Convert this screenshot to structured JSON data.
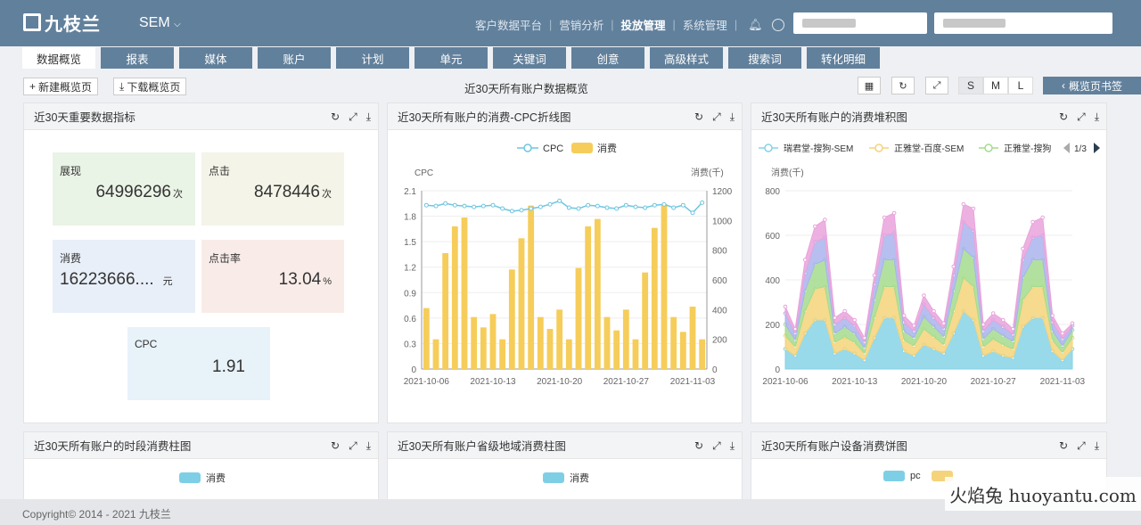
{
  "header": {
    "logo_text": "九枝兰",
    "product": "SEM",
    "nav": [
      "客户数据平台",
      "营销分析",
      "投放管理",
      "系统管理"
    ],
    "active_nav": "投放管理"
  },
  "tabs": [
    "数据概览",
    "报表",
    "媒体",
    "账户",
    "计划",
    "单元",
    "关键词",
    "创意",
    "高级样式",
    "搜索词",
    "转化明细"
  ],
  "toolbar": {
    "new_label": "新建概览页",
    "download_label": "下载概览页",
    "page_title": "近30天所有账户数据概览",
    "sizes": [
      "S",
      "M",
      "L"
    ],
    "active_size": "S",
    "bookmark_label": "概览页书签"
  },
  "panels": {
    "kpi": {
      "title": "近30天重要数据指标",
      "items": [
        {
          "label": "展现",
          "value": "64996296",
          "unit": "次",
          "color": "#eaf4e6"
        },
        {
          "label": "点击",
          "value": "8478446",
          "unit": "次",
          "color": "#f4f4e8"
        },
        {
          "label": "消费",
          "value": "16223666....",
          "unit": "元",
          "color": "#e8eff8"
        },
        {
          "label": "点击率",
          "value": "13.04",
          "unit": "%",
          "color": "#f9ece8"
        },
        {
          "label": "CPC",
          "value": "1.91",
          "unit": "",
          "color": "#e8f2f9"
        }
      ]
    },
    "cpc": {
      "title": "近30天所有账户的消费-CPC折线图"
    },
    "stack": {
      "title": "近30天所有账户的消费堆积图"
    },
    "hour": {
      "title": "近30天所有账户的时段消费柱图",
      "legend": "消费"
    },
    "region": {
      "title": "近30天所有账户省级地域消费柱图",
      "legend": "消费"
    },
    "device": {
      "title": "近30天所有账户设备消费饼图",
      "legend": [
        "pc"
      ]
    }
  },
  "chart_data": [
    {
      "type": "bar",
      "title": "",
      "left_axis_label": "CPC",
      "right_axis_label": "消费(千)",
      "legend": [
        "CPC",
        "消费"
      ],
      "x": [
        "2021-10-06",
        "2021-10-07",
        "2021-10-08",
        "2021-10-09",
        "2021-10-10",
        "2021-10-11",
        "2021-10-12",
        "2021-10-13",
        "2021-10-14",
        "2021-10-15",
        "2021-10-16",
        "2021-10-17",
        "2021-10-18",
        "2021-10-19",
        "2021-10-20",
        "2021-10-21",
        "2021-10-22",
        "2021-10-23",
        "2021-10-24",
        "2021-10-25",
        "2021-10-26",
        "2021-10-27",
        "2021-10-28",
        "2021-10-29",
        "2021-10-30",
        "2021-10-31",
        "2021-11-01",
        "2021-11-02",
        "2021-11-03",
        "2021-11-04"
      ],
      "x_ticks": [
        "2021-10-06",
        "2021-10-13",
        "2021-10-20",
        "2021-10-27",
        "2021-11-03"
      ],
      "consumption": [
        410,
        200,
        780,
        960,
        1020,
        350,
        280,
        370,
        200,
        670,
        880,
        1100,
        350,
        270,
        400,
        200,
        680,
        960,
        1010,
        350,
        260,
        400,
        200,
        650,
        950,
        1110,
        350,
        250,
        420,
        200
      ],
      "cpc": [
        1.93,
        1.92,
        1.95,
        1.93,
        1.92,
        1.91,
        1.92,
        1.93,
        1.89,
        1.86,
        1.87,
        1.89,
        1.91,
        1.94,
        1.98,
        1.9,
        1.89,
        1.93,
        1.92,
        1.9,
        1.89,
        1.93,
        1.91,
        1.9,
        1.93,
        1.94,
        1.9,
        1.93,
        1.84,
        1.96
      ],
      "left_ticks": [
        0,
        0.3,
        0.6,
        0.9,
        1.2,
        1.5,
        1.8,
        2.1
      ],
      "right_ticks": [
        0,
        200,
        400,
        600,
        800,
        1000,
        1200
      ],
      "series_colors": {
        "cpc": "#6fc6e0",
        "consumption": "#f6cd5a"
      }
    },
    {
      "type": "area",
      "title": "",
      "ylabel": "消费(千)",
      "legend": [
        "瑞君堂-搜狗-SEM",
        "正雅堂-百度-SEM",
        "正雅堂-搜狗"
      ],
      "legend_page": "1/3",
      "x_ticks": [
        "2021-10-06",
        "2021-10-13",
        "2021-10-20",
        "2021-10-27",
        "2021-11-03"
      ],
      "y_ticks": [
        0,
        200,
        400,
        600,
        800
      ],
      "layers": [
        {
          "color": "#86d3e6",
          "values": [
            90,
            60,
            160,
            220,
            220,
            70,
            90,
            70,
            40,
            140,
            230,
            230,
            80,
            60,
            110,
            90,
            70,
            160,
            260,
            220,
            60,
            80,
            60,
            50,
            190,
            230,
            230,
            80,
            40,
            90
          ]
        },
        {
          "color": "#f5d37a",
          "values": [
            60,
            40,
            100,
            140,
            150,
            50,
            55,
            50,
            30,
            90,
            140,
            140,
            50,
            45,
            70,
            55,
            40,
            100,
            150,
            150,
            40,
            55,
            50,
            40,
            120,
            140,
            140,
            50,
            35,
            50
          ]
        },
        {
          "color": "#a5dc8e",
          "values": [
            50,
            30,
            90,
            110,
            120,
            40,
            45,
            40,
            25,
            80,
            120,
            120,
            40,
            35,
            55,
            45,
            35,
            90,
            130,
            130,
            35,
            45,
            40,
            35,
            100,
            120,
            120,
            40,
            30,
            35
          ]
        },
        {
          "color": "#a9b4ec",
          "values": [
            50,
            30,
            80,
            100,
            100,
            40,
            40,
            35,
            25,
            70,
            110,
            120,
            40,
            30,
            55,
            40,
            35,
            70,
            120,
            120,
            35,
            40,
            40,
            30,
            80,
            100,
            110,
            40,
            30,
            20
          ]
        },
        {
          "color": "#e9a3dc",
          "values": [
            30,
            20,
            60,
            70,
            80,
            30,
            30,
            25,
            20,
            40,
            80,
            90,
            30,
            25,
            40,
            30,
            25,
            40,
            80,
            100,
            30,
            30,
            30,
            25,
            50,
            70,
            80,
            30,
            25,
            10
          ]
        }
      ]
    }
  ]
}
